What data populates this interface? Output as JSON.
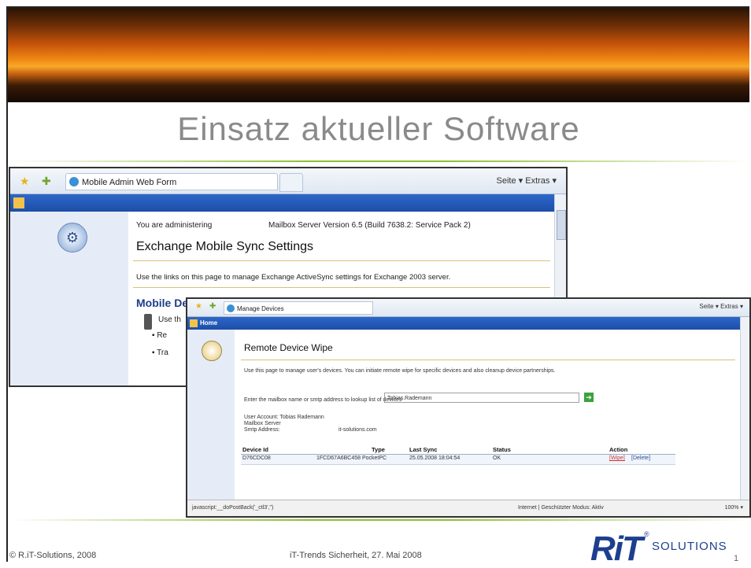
{
  "slide": {
    "title": "Einsatz aktueller Software",
    "footer_left": "© R.iT-Solutions, 2008",
    "footer_middle": "iT-Trends Sicherheit, 27. Mai 2008",
    "page_number": "1",
    "logo_mark": "RiT",
    "logo_text": "SOLUTIONS",
    "logo_reg": "®",
    "accent_color": "#8fbf33"
  },
  "browser1": {
    "tab_title": "Mobile Admin Web Form",
    "toolbar_right": "Seite ▾  Extras ▾",
    "admin_label": "You are administering",
    "server_info": "Mailbox Server Version 6.5 (Build 7638.2: Service Pack 2)",
    "heading": "Exchange Mobile Sync Settings",
    "description": "Use the links on this page to manage Exchange ActiveSync settings for Exchange 2003 server.",
    "section_heading": "Mobile Device Settings",
    "use_fragment": "Use th",
    "item1": "Re",
    "item2": "Tra"
  },
  "browser2": {
    "tab_title": "Manage Devices",
    "toolbar_right": "Seite ▾  Extras ▾",
    "nav_label": "Home",
    "heading": "Remote Device Wipe",
    "description": "Use this page to manage user's devices. You can initiate remote wipe for specific devices and also cleanup device partnerships.",
    "lookup_label": "Enter the mailbox name or smtp address to lookup list of devices",
    "lookup_value": "Tobias.Rademann",
    "user_account": "User Account: Tobias Rademann",
    "mailbox_server": "Mailbox Server",
    "smtp_label": "Smtp Address:",
    "smtp_value": "it-solutions.com",
    "table": {
      "headers": [
        "Device Id",
        "Type",
        "Last Sync",
        "Status",
        "Action"
      ],
      "row": {
        "device_id": "D76CDC08",
        "type": "1FCD67A6BC458 PocketPC",
        "last_sync": "25.05.2008 18:04:54",
        "status": "OK",
        "wipe": "[Wipe]",
        "delete": "[Delete]"
      }
    },
    "status_left": "javascript:__doPostBack('_ctl3','')",
    "status_middle": "Internet | Geschützter Modus: Aktiv",
    "status_right": "100% ▾"
  }
}
